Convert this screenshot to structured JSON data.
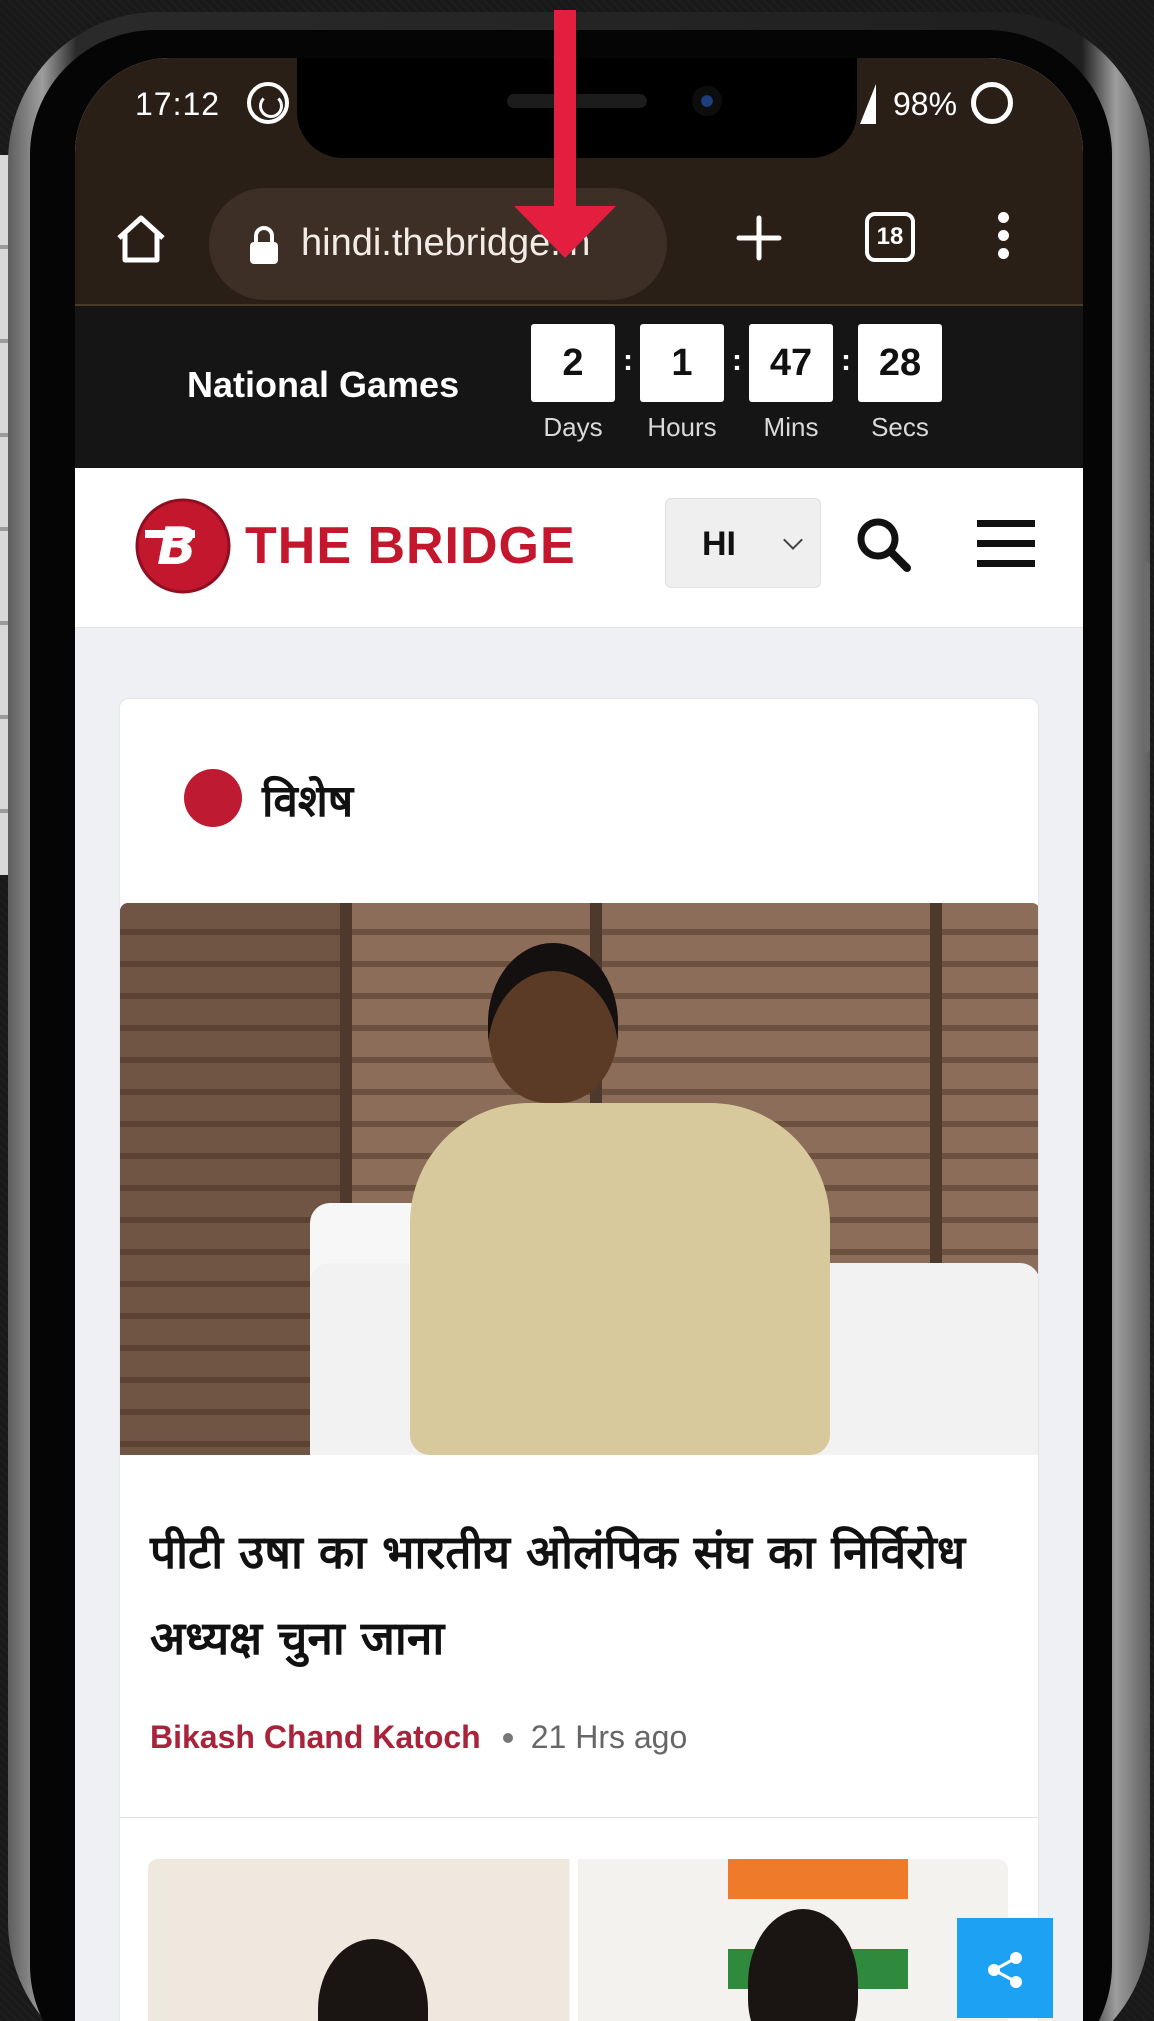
{
  "status_bar": {
    "time": "17:12",
    "battery": "98%"
  },
  "browser": {
    "url": "hindi.thebridge.in",
    "tab_count": "18"
  },
  "countdown": {
    "label": "National Games",
    "units": [
      {
        "value": "2",
        "caption": "Days"
      },
      {
        "value": "1",
        "caption": "Hours"
      },
      {
        "value": "47",
        "caption": "Mins"
      },
      {
        "value": "28",
        "caption": "Secs"
      }
    ]
  },
  "header": {
    "logo_text": "THE BRIDGE",
    "language": "HI"
  },
  "article": {
    "category": "विशेष",
    "headline": "पीटी उषा का भारतीय ओलंपिक संघ का निर्विरोध अध्यक्ष चुना जाना",
    "author": "Bikash Chand Katoch",
    "time_ago": "21 Hrs ago"
  },
  "colors": {
    "brand_red": "#c3172e",
    "category_dot": "#be1b32",
    "share_blue": "#1da1f2",
    "browser_bar": "#2a1f17",
    "annotation_arrow": "#e41e3f"
  }
}
